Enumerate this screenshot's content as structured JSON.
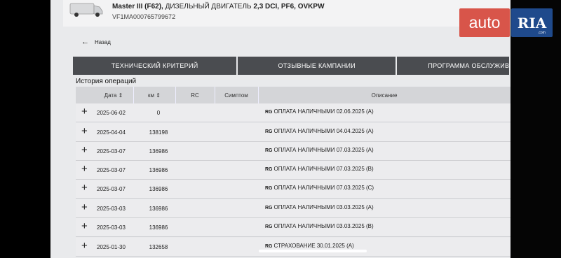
{
  "vehicle": {
    "model_bold": "Master III (F62),",
    "model_rest": " ДИЗЕЛЬНЫЙ ДВИГАТЕЛЬ ",
    "engine": "2,3 DCI, PF6, OVKPW",
    "vin": "VF1MA000765799672"
  },
  "nav": {
    "back_label": "Назад"
  },
  "tabs": [
    {
      "label": "ТЕХНИЧЕСКИЙ КРИТЕРИЙ"
    },
    {
      "label": "ОТЗЫВНЫЕ КАМПАНИИ"
    },
    {
      "label": "ПРОГРАММА ОБСЛУЖИВАН"
    }
  ],
  "history": {
    "title": "История операций",
    "columns": {
      "date": "Дата",
      "km": "км",
      "rc": "RC",
      "symptom": "Симптом",
      "description": "Описание"
    },
    "rows": [
      {
        "date": "2025-06-02",
        "km": "0",
        "tag": "RG",
        "desc": "ОПЛАТА НАЛИЧНЫМИ 02.06.2025 (A)"
      },
      {
        "date": "2025-04-04",
        "km": "138198",
        "tag": "RG",
        "desc": "ОПЛАТА НАЛИЧНЫМИ 04.04.2025 (A)"
      },
      {
        "date": "2025-03-07",
        "km": "136986",
        "tag": "RG",
        "desc": "ОПЛАТА НАЛИЧНЫМИ 07.03.2025 (A)"
      },
      {
        "date": "2025-03-07",
        "km": "136986",
        "tag": "RG",
        "desc": "ОПЛАТА НАЛИЧНЫМИ 07.03.2025 (B)"
      },
      {
        "date": "2025-03-07",
        "km": "136986",
        "tag": "RG",
        "desc": "ОПЛАТА НАЛИЧНЫМИ 07.03.2025 (C)"
      },
      {
        "date": "2025-03-03",
        "km": "136986",
        "tag": "RG",
        "desc": "ОПЛАТА НАЛИЧНЫМИ 03.03.2025 (A)"
      },
      {
        "date": "2025-03-03",
        "km": "136986",
        "tag": "RG",
        "desc": "ОПЛАТА НАЛИЧНЫМИ 03.03.2025 (B)"
      },
      {
        "date": "2025-01-30",
        "km": "132658",
        "tag": "RG",
        "desc": "СТРАХОВАНИЕ 30.01.2025 (A)"
      }
    ]
  },
  "watermark": {
    "auto": "auto",
    "ria": "RIA",
    "sub": ".com"
  },
  "colors": {
    "tab_bg": "#4a4c50",
    "logo_red": "#d8554a",
    "logo_blue": "#1f4a8c"
  }
}
